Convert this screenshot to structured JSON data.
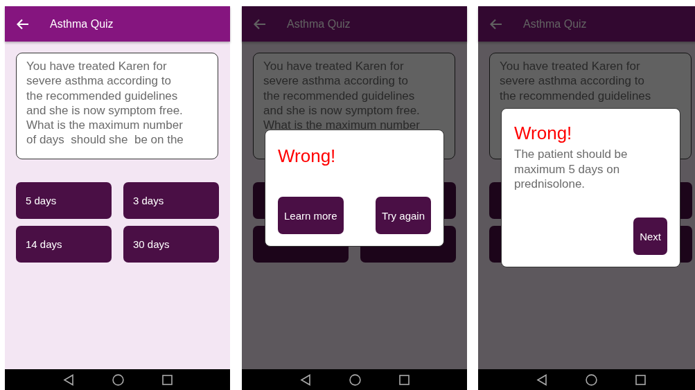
{
  "screens": [
    {
      "title": "Asthma Quiz",
      "dimmed": false,
      "question_lines": [
        "You have treated Karen for",
        "severe asthma according to",
        "the recommended guidelines",
        "and she is now symptom free.",
        "What is the maximum number",
        "of days  should she  be on the"
      ],
      "answers": [
        "5 days",
        "3 days",
        "14 days",
        "30 days"
      ]
    },
    {
      "title": "Asthma Quiz",
      "dimmed": true,
      "question_lines": [
        "You have treated Karen for",
        "severe asthma according to",
        "the recommended guidelines",
        "and she is now symptom free.",
        "What is the maximum number"
      ],
      "dialog": {
        "title": "Wrong!",
        "buttons": [
          "Learn more",
          "Try again"
        ]
      }
    },
    {
      "title": "Asthma Quiz",
      "dimmed": true,
      "question_lines": [
        "You have treated Karen for",
        "severe asthma according to",
        "the recommended guidelines"
      ],
      "dialog": {
        "title": "Wrong!",
        "message": "The patient should be maximum 5 days on prednisolone.",
        "buttons": [
          "Next"
        ]
      }
    }
  ]
}
